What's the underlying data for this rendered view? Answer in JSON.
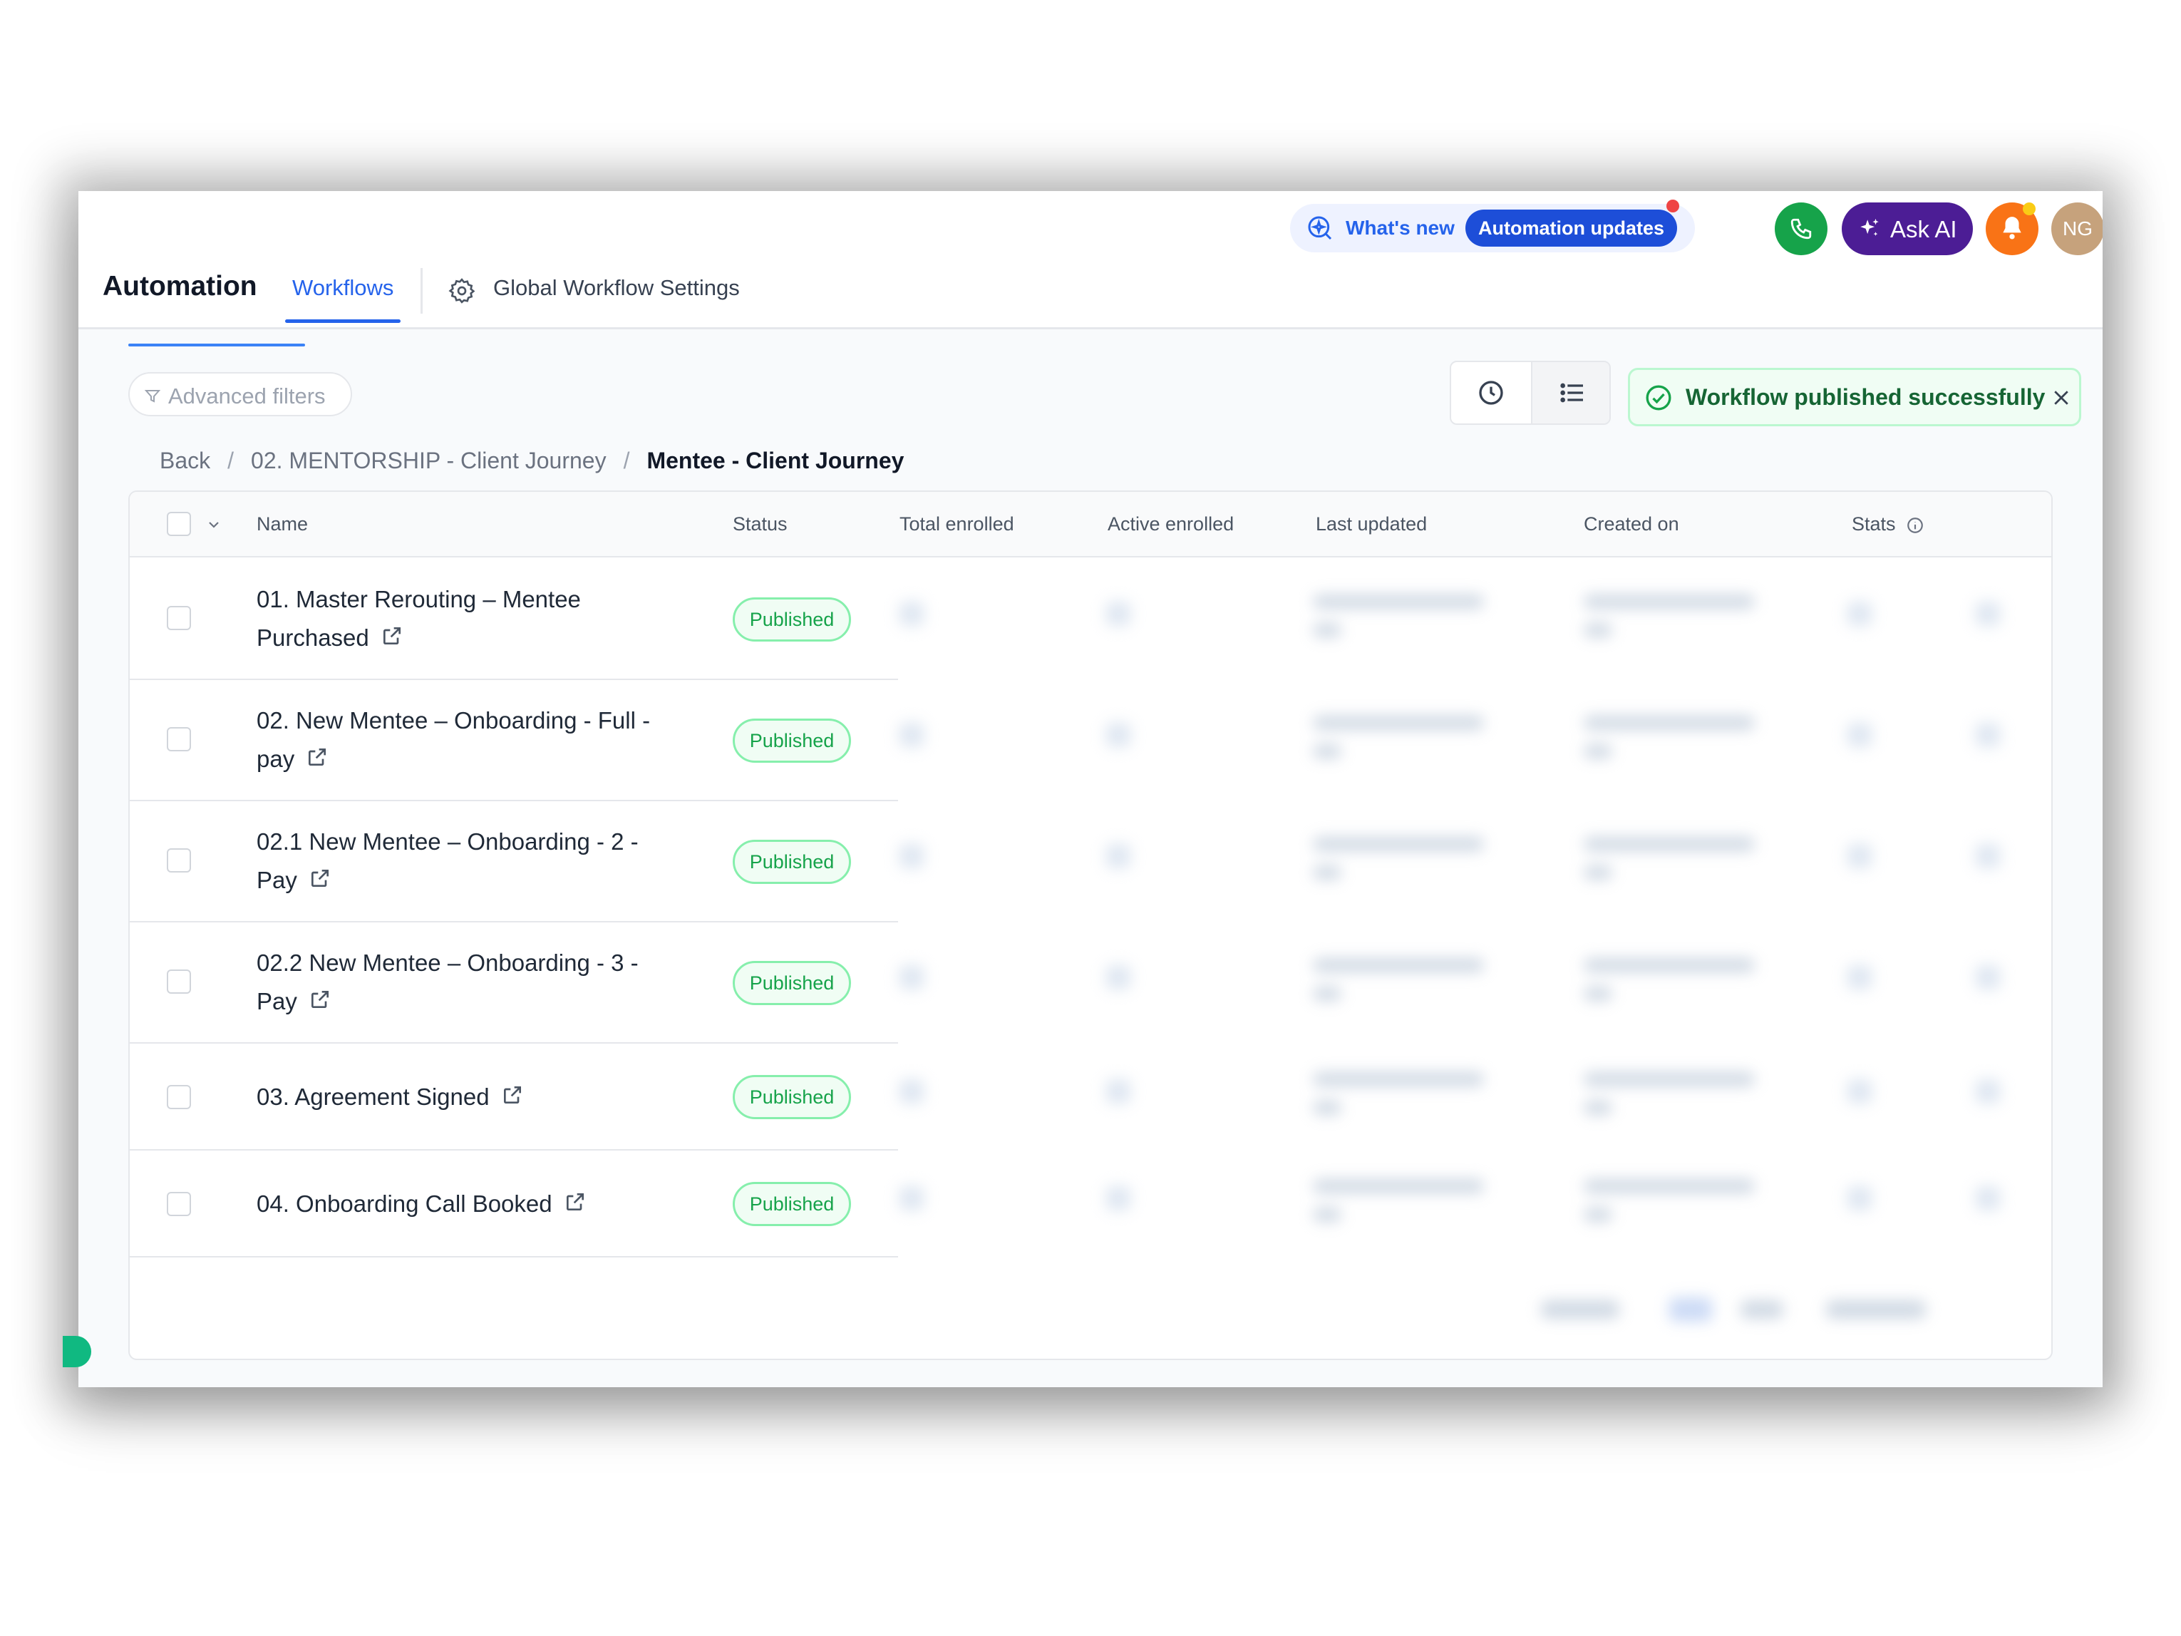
{
  "app": {
    "title": "Automation",
    "tabs": [
      {
        "label": "Workflows",
        "active": true
      },
      {
        "label": "Global Workflow Settings",
        "active": false
      }
    ]
  },
  "header": {
    "whats_new_label": "What's new",
    "automation_updates_label": "Automation updates",
    "ask_ai_label": "Ask AI",
    "avatar_initials": "NG",
    "colors": {
      "phone": "#16a34a",
      "ask_ai": "#4c1d95",
      "bell": "#f97316",
      "avatar": "#c6a27c",
      "accent": "#2563eb"
    }
  },
  "toolbar": {
    "advanced_filters_label": "Advanced filters",
    "view_icons": [
      "clock-icon",
      "list-icon"
    ]
  },
  "toast": {
    "message": "Workflow published successfully",
    "color": "#16a34a"
  },
  "breadcrumb": {
    "back": "Back",
    "parent": "02. MENTORSHIP - Client Journey",
    "current": "Mentee - Client Journey",
    "separator": "/"
  },
  "table": {
    "columns": [
      "Name",
      "Status",
      "Total enrolled",
      "Active enrolled",
      "Last updated",
      "Created on",
      "Stats"
    ],
    "rows": [
      {
        "name_line1": "01. Master Rerouting – Mentee",
        "name_line2": "Purchased",
        "status": "Published"
      },
      {
        "name_line1": "02. New Mentee – Onboarding - Full -",
        "name_line2": "pay",
        "status": "Published"
      },
      {
        "name_line1": "02.1 New Mentee – Onboarding - 2 -",
        "name_line2": "Pay",
        "status": "Published"
      },
      {
        "name_line1": "02.2 New Mentee – Onboarding - 3 -",
        "name_line2": "Pay",
        "status": "Published"
      },
      {
        "name_line1": "03. Agreement Signed",
        "name_line2": "",
        "status": "Published"
      },
      {
        "name_line1": "04. Onboarding Call Booked",
        "name_line2": "",
        "status": "Published"
      }
    ]
  }
}
